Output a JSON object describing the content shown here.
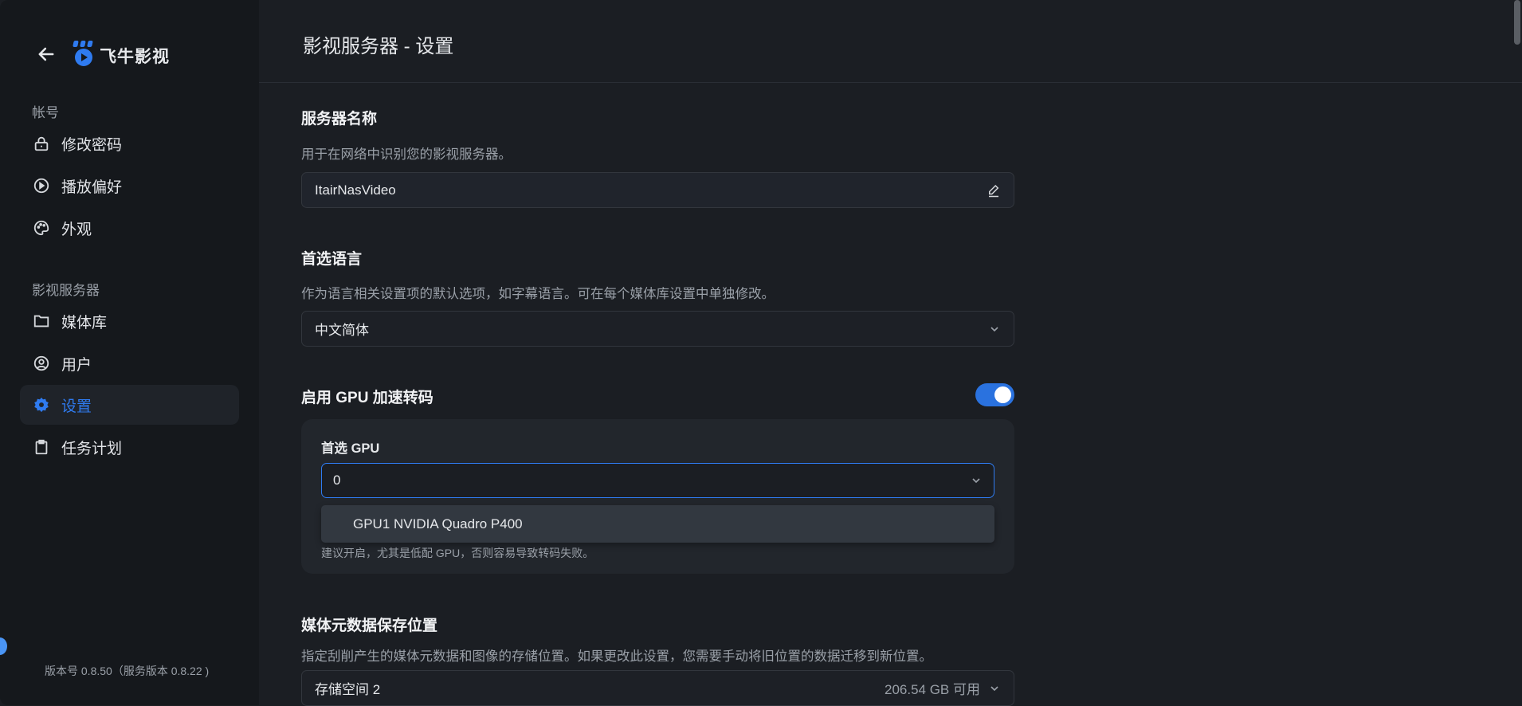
{
  "app": {
    "name": "飞牛影视",
    "back_label": "返回"
  },
  "sidebar": {
    "groups": [
      {
        "label": "帐号"
      },
      {
        "label": "影视服务器"
      }
    ],
    "items": [
      {
        "label": "修改密码",
        "icon": "lock-icon"
      },
      {
        "label": "播放偏好",
        "icon": "play-circle-icon"
      },
      {
        "label": "外观",
        "icon": "palette-icon"
      },
      {
        "label": "媒体库",
        "icon": "folder-icon"
      },
      {
        "label": "用户",
        "icon": "user-circle-icon"
      },
      {
        "label": "设置",
        "icon": "gear-icon",
        "active": true
      },
      {
        "label": "任务计划",
        "icon": "clipboard-icon"
      }
    ],
    "version": "版本号 0.8.50（服务版本 0.8.22 )"
  },
  "header": {
    "title": "影视服务器 - 设置"
  },
  "settings": {
    "server_name": {
      "title": "服务器名称",
      "desc": "用于在网络中识别您的影视服务器。",
      "value": "ItairNasVideo"
    },
    "language": {
      "title": "首选语言",
      "desc": "作为语言相关设置项的默认选项，如字幕语言。可在每个媒体库设置中单独修改。",
      "value": "中文简体"
    },
    "gpu": {
      "title": "启用 GPU 加速转码",
      "enabled": true,
      "preferred_label": "首选 GPU",
      "preferred_value": "0",
      "options": [
        "GPU1 NVIDIA Quadro P400"
      ],
      "hint": "建议开启，尤其是低配 GPU，否则容易导致转码失败。"
    },
    "metadata": {
      "title": "媒体元数据保存位置",
      "desc": "指定刮削产生的媒体元数据和图像的存储位置。如果更改此设置，您需要手动将旧位置的数据迁移到新位置。",
      "value": "存储空间 2",
      "available": "206.54 GB 可用"
    }
  },
  "colors": {
    "accent": "#2f7bf0",
    "sidebar_bg": "#15181c",
    "main_bg": "#1b1e23"
  }
}
